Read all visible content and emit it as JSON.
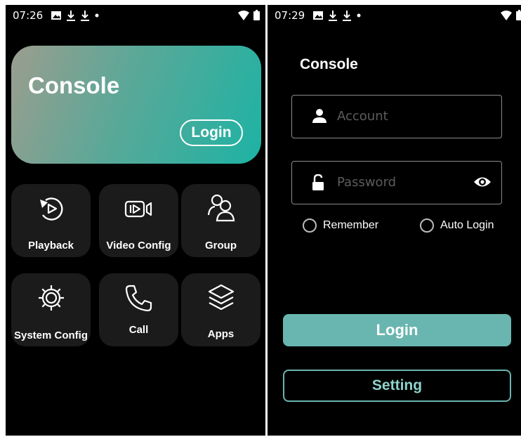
{
  "left": {
    "status_bar": {
      "time": "07:26"
    },
    "hero": {
      "title": "Console",
      "login_label": "Login"
    },
    "tiles": [
      {
        "label": "Playback",
        "icon": "playback-icon"
      },
      {
        "label": "Video Config",
        "icon": "video-config-icon"
      },
      {
        "label": "Group",
        "icon": "group-icon"
      },
      {
        "label": "System Config",
        "icon": "gear-icon"
      },
      {
        "label": "Call",
        "icon": "phone-icon"
      },
      {
        "label": "Apps",
        "icon": "layers-icon"
      }
    ]
  },
  "right": {
    "status_bar": {
      "time": "07:29"
    },
    "title": "Console",
    "account": {
      "placeholder": "Account",
      "value": ""
    },
    "password": {
      "placeholder": "Password",
      "value": ""
    },
    "remember_label": "Remember",
    "auto_login_label": "Auto Login",
    "login_label": "Login",
    "setting_label": "Setting"
  },
  "colors": {
    "accent": "#69b5b0",
    "hero_start": "#9b9d8e",
    "hero_end": "#1db3a4",
    "tile_bg": "#1b1b1b"
  }
}
